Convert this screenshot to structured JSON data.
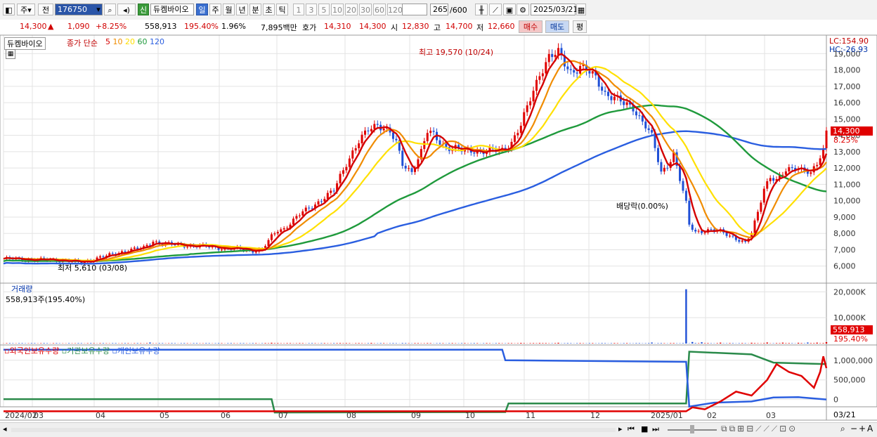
{
  "toolbar": {
    "type_select": "주",
    "prev_label": "전",
    "code_value": "176750",
    "new_badge": "신",
    "stock_name": "듀켐바이오",
    "periods": [
      "일",
      "주",
      "월",
      "년",
      "분",
      "초",
      "틱"
    ],
    "intervals": [
      "1",
      "3",
      "5",
      "10",
      "20",
      "30",
      "60",
      "120"
    ],
    "count": "265",
    "count_total": "/600",
    "date": "2025/03/21"
  },
  "quote": {
    "price": "14,300",
    "change_sign": "▲",
    "change": "1,090",
    "change_pct": "+8.25%",
    "volume": "558,913",
    "volume_ratio": "195.40%",
    "turnover": "1.96%",
    "amount": "7,895백만",
    "ask_label": "호가",
    "ask": "14,310",
    "bid": "14,300",
    "open_label": "시",
    "open": "12,830",
    "high_label": "고",
    "high": "14,700",
    "low_label": "저",
    "low": "12,660",
    "buy_label": "매수",
    "sell_label": "매도",
    "eval_label": "평"
  },
  "price_panel": {
    "stock_label": "듀켐바이오",
    "ma_title": "종가 단순",
    "ma_periods": [
      "5",
      "10",
      "20",
      "60",
      "120"
    ],
    "ma_colors": [
      "#d40000",
      "#f08c00",
      "#ffe000",
      "#1f9a3c",
      "#2a5ee0"
    ],
    "lc": "LC:154.90",
    "hc": "HC:-26.93",
    "high_annot": "최고 19,570 (10/24)",
    "low_annot": "최저 5,610 (03/08)",
    "dividend_annot": "배당락(0.00%)",
    "last_price_tag": "14,300",
    "last_pct_tag": "8.25%",
    "y_ticks": [
      "19,000",
      "18,000",
      "17,000",
      "16,000",
      "15,000",
      "14,000",
      "13,000",
      "12,000",
      "11,000",
      "10,000",
      "9,000",
      "8,000",
      "7,000",
      "6,000"
    ]
  },
  "volume_panel": {
    "title": "거래량",
    "value": "558,913주(195.40%)",
    "y_ticks": [
      "20,000K",
      "10,000K"
    ],
    "tag_value": "558,913",
    "tag_pct": "195.40%"
  },
  "holdings_panel": {
    "legend": [
      "외국인보유수량",
      "기관보유수량",
      "개인보유수량"
    ],
    "y_ticks": [
      "1,000,000",
      "500,000",
      "0"
    ]
  },
  "x_axis": {
    "labels": [
      "2024/02",
      "03",
      "04",
      "05",
      "06",
      "07",
      "08",
      "09",
      "10",
      "11",
      "12",
      "2025/01",
      "02",
      "03"
    ],
    "right_label": "03/21"
  },
  "chart_data": [
    {
      "type": "line",
      "title": "종가 단순",
      "series": [
        {
          "name": "5",
          "color": "#d40000"
        },
        {
          "name": "10",
          "color": "#f08c00"
        },
        {
          "name": "20",
          "color": "#ffe000"
        },
        {
          "name": "60",
          "color": "#1f9a3c"
        },
        {
          "name": "120",
          "color": "#2a5ee0"
        }
      ],
      "ylim": [
        5000,
        19700
      ],
      "close_series": [
        [
          0,
          6450
        ],
        [
          10,
          6400
        ],
        [
          20,
          6350
        ],
        [
          25,
          6200
        ],
        [
          30,
          6500
        ],
        [
          35,
          6700
        ],
        [
          40,
          7000
        ],
        [
          45,
          7100
        ],
        [
          48,
          7550
        ],
        [
          50,
          7400
        ],
        [
          55,
          7300
        ],
        [
          60,
          7250
        ],
        [
          65,
          7200
        ],
        [
          70,
          7100
        ],
        [
          75,
          7050
        ],
        [
          80,
          6950
        ],
        [
          83,
          7000
        ],
        [
          86,
          7800
        ],
        [
          88,
          8200
        ],
        [
          90,
          8300
        ],
        [
          93,
          8800
        ],
        [
          96,
          9300
        ],
        [
          100,
          9800
        ],
        [
          103,
          10200
        ],
        [
          106,
          10600
        ],
        [
          108,
          11500
        ],
        [
          110,
          12300
        ],
        [
          112,
          13000
        ],
        [
          114,
          13600
        ],
        [
          117,
          14300
        ],
        [
          120,
          14700
        ],
        [
          122,
          14500
        ],
        [
          124,
          14200
        ],
        [
          126,
          13500
        ],
        [
          128,
          12200
        ],
        [
          131,
          11800
        ],
        [
          134,
          13000
        ],
        [
          136,
          14200
        ],
        [
          138,
          14000
        ],
        [
          140,
          13600
        ],
        [
          142,
          13300
        ],
        [
          145,
          13200
        ],
        [
          148,
          13000
        ],
        [
          151,
          13100
        ],
        [
          155,
          13000
        ],
        [
          160,
          13100
        ],
        [
          163,
          13600
        ],
        [
          166,
          14600
        ],
        [
          169,
          16200
        ],
        [
          172,
          17800
        ],
        [
          175,
          18800
        ],
        [
          178,
          19000
        ],
        [
          180,
          18400
        ],
        [
          182,
          17900
        ],
        [
          185,
          18200
        ],
        [
          188,
          17800
        ],
        [
          190,
          17500
        ],
        [
          193,
          16600
        ],
        [
          196,
          16300
        ],
        [
          199,
          15900
        ],
        [
          202,
          15700
        ],
        [
          206,
          14600
        ],
        [
          208,
          13900
        ],
        [
          211,
          11700
        ],
        [
          213,
          12200
        ],
        [
          215,
          12900
        ],
        [
          217,
          11300
        ],
        [
          219,
          9800
        ],
        [
          220,
          8500
        ],
        [
          222,
          8100
        ],
        [
          226,
          8200
        ],
        [
          230,
          8100
        ],
        [
          234,
          7800
        ],
        [
          236,
          7600
        ],
        [
          238,
          7400
        ],
        [
          240,
          8000
        ],
        [
          242,
          9300
        ],
        [
          244,
          10800
        ],
        [
          246,
          11500
        ],
        [
          248,
          11200
        ],
        [
          251,
          11800
        ],
        [
          254,
          12100
        ],
        [
          257,
          11900
        ],
        [
          259,
          11600
        ],
        [
          261,
          12200
        ],
        [
          263,
          13100
        ],
        [
          264,
          14300
        ]
      ]
    },
    {
      "type": "bar",
      "title": "거래량",
      "values_k": [
        [
          0,
          60
        ],
        [
          20,
          80
        ],
        [
          40,
          150
        ],
        [
          47,
          400
        ],
        [
          86,
          300
        ],
        [
          108,
          200
        ],
        [
          118,
          250
        ],
        [
          128,
          200
        ],
        [
          136,
          180
        ],
        [
          166,
          250
        ],
        [
          172,
          220
        ],
        [
          178,
          300
        ],
        [
          208,
          400
        ],
        [
          219,
          21000
        ],
        [
          221,
          600
        ],
        [
          224,
          500
        ],
        [
          230,
          350
        ],
        [
          240,
          300
        ],
        [
          245,
          400
        ],
        [
          250,
          350
        ],
        [
          255,
          300
        ],
        [
          258,
          400
        ],
        [
          261,
          350
        ],
        [
          264,
          559
        ]
      ]
    },
    {
      "type": "line",
      "series": [
        {
          "name": "외국인보유수량",
          "color": "#e00000"
        },
        {
          "name": "기관보유수량",
          "color": "#2a8a4a"
        },
        {
          "name": "개인보유수량",
          "color": "#2a5ee0"
        }
      ]
    }
  ]
}
